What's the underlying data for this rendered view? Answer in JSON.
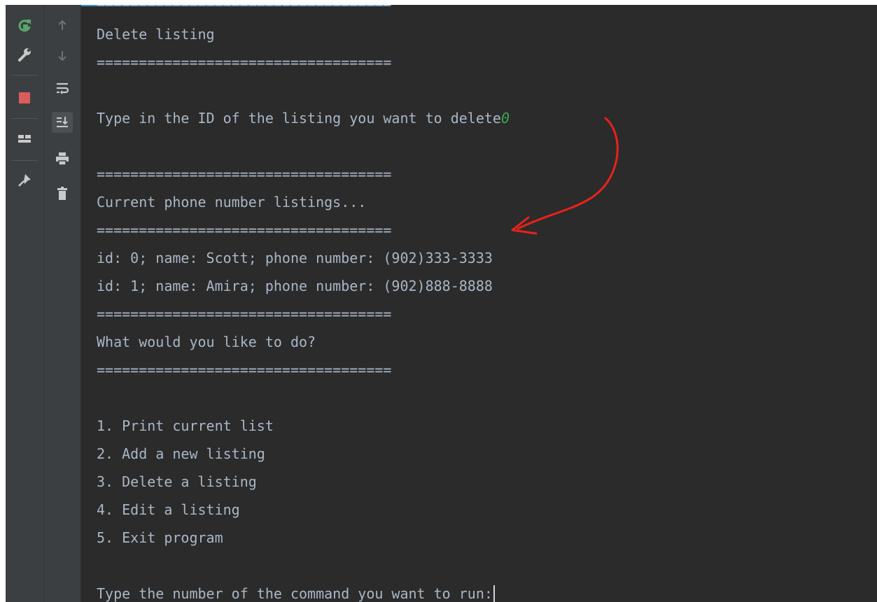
{
  "toolbar_left": {
    "buttons": [
      {
        "icon": "rerun-icon",
        "color": "#59a869"
      },
      {
        "icon": "wrench-icon",
        "color": "#c9c9c9"
      },
      {
        "icon": "stop-icon",
        "color": "#db5c5c"
      },
      {
        "icon": "layout-icon",
        "color": "#c9c9c9"
      },
      {
        "icon": "pin-icon",
        "color": "#c9c9c9"
      }
    ]
  },
  "toolbar_right": {
    "buttons": [
      {
        "icon": "up-arrow-icon"
      },
      {
        "icon": "down-arrow-icon"
      },
      {
        "icon": "soft-wrap-icon"
      },
      {
        "icon": "scroll-to-end-icon"
      },
      {
        "icon": "print-icon"
      },
      {
        "icon": "trash-icon"
      }
    ]
  },
  "console": {
    "top_partial": "===================================",
    "heading": "Delete listing",
    "sep1": "===================================",
    "prompt_delete": "Type in the ID of the listing you want to delete",
    "prompt_delete_input": "0",
    "sep2": "===================================",
    "current_heading": "Current phone number listings...",
    "sep3": "===================================",
    "listings": [
      "id: 0; name: Scott; phone number: (902)333-3333",
      "id: 1; name: Amira; phone number: (902)888-8888"
    ],
    "sep4": "===================================",
    "question": "What would you like to do?",
    "sep5": "===================================",
    "menu": [
      "1. Print current list",
      "2. Add a new listing",
      "3. Delete a listing",
      "4. Edit a listing",
      "5. Exit program"
    ],
    "command_prompt": "Type the number of the command you want to run:"
  },
  "colors": {
    "console_bg": "#2b2b2b",
    "console_text": "#a9b7c6",
    "input_text": "#3aa552",
    "annotation_red": "#e8221a"
  }
}
